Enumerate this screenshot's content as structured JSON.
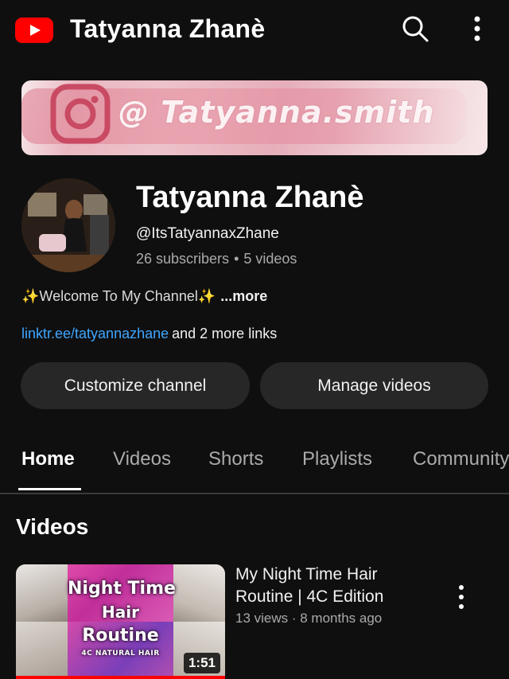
{
  "topbar": {
    "title": "Tatyanna Zhanè",
    "logo_icon": "youtube-logo-icon",
    "search_icon": "search-icon",
    "more_icon": "more-vert-icon"
  },
  "banner": {
    "handle_text": "@ Tatyanna.smith",
    "icon": "instagram-icon"
  },
  "channel": {
    "name": "Tatyanna Zhanè",
    "handle": "@ItsTatyannaxZhane",
    "subscribers": "26 subscribers",
    "separator": "•",
    "videos_count": "5 videos",
    "description": "✨Welcome To My Channel✨",
    "more_label": "...more",
    "link": "linktr.ee/tatyannazhane",
    "more_links": "and 2 more links"
  },
  "buttons": {
    "customize": "Customize channel",
    "manage": "Manage videos"
  },
  "tabs": [
    {
      "label": "Home",
      "active": true
    },
    {
      "label": "Videos",
      "active": false
    },
    {
      "label": "Shorts",
      "active": false
    },
    {
      "label": "Playlists",
      "active": false
    },
    {
      "label": "Community",
      "active": false
    }
  ],
  "section": {
    "title": "Videos"
  },
  "video": {
    "title": "My Night Time Hair Routine | 4C Edition",
    "meta": "13 views · 8 months ago",
    "duration": "1:51",
    "thumb_line1": "Night Time",
    "thumb_line2": "Hair",
    "thumb_line3": "Routine",
    "thumb_line4": "4C NATURAL HAIR"
  },
  "colors": {
    "background": "#0f0f0f",
    "accent": "#ff0000",
    "link": "#3ea6ff",
    "button_bg": "#272727",
    "muted_text": "#aaaaaa"
  }
}
